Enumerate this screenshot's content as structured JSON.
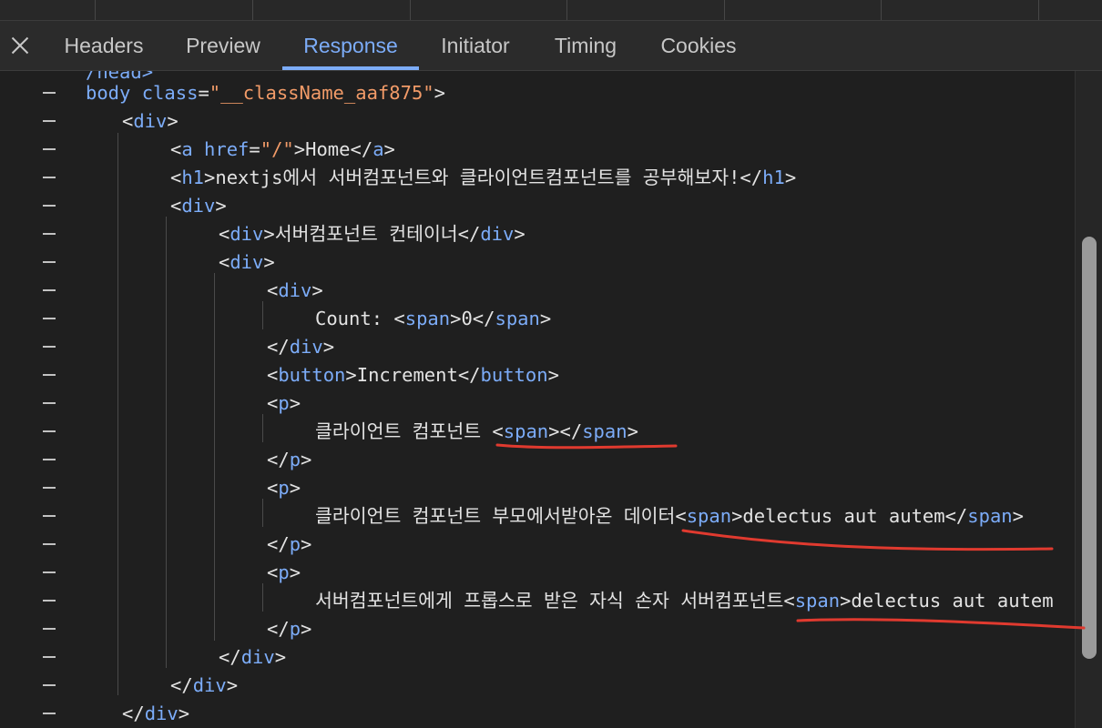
{
  "tabs": {
    "headers": "Headers",
    "preview": "Preview",
    "response": "Response",
    "initiator": "Initiator",
    "timing": "Timing",
    "cookies": "Cookies",
    "active": "Response"
  },
  "icons": {
    "close": "close-icon"
  },
  "colors": {
    "accent": "#7cacf8",
    "tag": "#7cacf8",
    "string": "#f29b68",
    "text": "#e3e3e3",
    "background": "#1f1f1f",
    "annotation": "#e03a2f"
  },
  "code": {
    "partial_head": "/head>",
    "body_open": [
      {
        "t": "at",
        "v": "body"
      },
      {
        "t": "tx",
        "v": " "
      },
      {
        "t": "at",
        "v": "class"
      },
      {
        "t": "tx",
        "v": "="
      },
      {
        "t": "st",
        "v": "\"__className_aaf875\""
      },
      {
        "t": "tx",
        "v": ">"
      }
    ],
    "lines": [
      [
        {
          "t": "tx",
          "v": "<"
        },
        {
          "t": "tg",
          "v": "div"
        },
        {
          "t": "tx",
          "v": ">"
        }
      ],
      [
        {
          "t": "tx",
          "v": "<"
        },
        {
          "t": "tg",
          "v": "a"
        },
        {
          "t": "tx",
          "v": " "
        },
        {
          "t": "at",
          "v": "href"
        },
        {
          "t": "tx",
          "v": "="
        },
        {
          "t": "st",
          "v": "\"/\""
        },
        {
          "t": "tx",
          "v": ">Home</"
        },
        {
          "t": "tg",
          "v": "a"
        },
        {
          "t": "tx",
          "v": ">"
        }
      ],
      [
        {
          "t": "tx",
          "v": "<"
        },
        {
          "t": "tg",
          "v": "h1"
        },
        {
          "t": "tx",
          "v": ">nextjs에서 서버컴포넌트와 클라이언트컴포넌트를 공부해보자!</"
        },
        {
          "t": "tg",
          "v": "h1"
        },
        {
          "t": "tx",
          "v": ">"
        }
      ],
      [
        {
          "t": "tx",
          "v": "<"
        },
        {
          "t": "tg",
          "v": "div"
        },
        {
          "t": "tx",
          "v": ">"
        }
      ],
      [
        {
          "t": "tx",
          "v": "<"
        },
        {
          "t": "tg",
          "v": "div"
        },
        {
          "t": "tx",
          "v": ">서버컴포넌트 컨테이너</"
        },
        {
          "t": "tg",
          "v": "div"
        },
        {
          "t": "tx",
          "v": ">"
        }
      ],
      [
        {
          "t": "tx",
          "v": "<"
        },
        {
          "t": "tg",
          "v": "div"
        },
        {
          "t": "tx",
          "v": ">"
        }
      ],
      [
        {
          "t": "tx",
          "v": "<"
        },
        {
          "t": "tg",
          "v": "div"
        },
        {
          "t": "tx",
          "v": ">"
        }
      ],
      [
        {
          "t": "tx",
          "v": "Count: <"
        },
        {
          "t": "tg",
          "v": "span"
        },
        {
          "t": "tx",
          "v": ">0</"
        },
        {
          "t": "tg",
          "v": "span"
        },
        {
          "t": "tx",
          "v": ">"
        }
      ],
      [
        {
          "t": "tx",
          "v": "</"
        },
        {
          "t": "tg",
          "v": "div"
        },
        {
          "t": "tx",
          "v": ">"
        }
      ],
      [
        {
          "t": "tx",
          "v": "<"
        },
        {
          "t": "tg",
          "v": "button"
        },
        {
          "t": "tx",
          "v": ">Increment</"
        },
        {
          "t": "tg",
          "v": "button"
        },
        {
          "t": "tx",
          "v": ">"
        }
      ],
      [
        {
          "t": "tx",
          "v": "<"
        },
        {
          "t": "tg",
          "v": "p"
        },
        {
          "t": "tx",
          "v": ">"
        }
      ],
      [
        {
          "t": "tx",
          "v": "클라이언트 컴포넌트 <"
        },
        {
          "t": "tg",
          "v": "span"
        },
        {
          "t": "tx",
          "v": "></"
        },
        {
          "t": "tg",
          "v": "span"
        },
        {
          "t": "tx",
          "v": ">"
        }
      ],
      [
        {
          "t": "tx",
          "v": "</"
        },
        {
          "t": "tg",
          "v": "p"
        },
        {
          "t": "tx",
          "v": ">"
        }
      ],
      [
        {
          "t": "tx",
          "v": "<"
        },
        {
          "t": "tg",
          "v": "p"
        },
        {
          "t": "tx",
          "v": ">"
        }
      ],
      [
        {
          "t": "tx",
          "v": "클라이언트 컴포넌트 부모에서받아온 데이터<"
        },
        {
          "t": "tg",
          "v": "span"
        },
        {
          "t": "tx",
          "v": ">delectus aut autem</"
        },
        {
          "t": "tg",
          "v": "span"
        },
        {
          "t": "tx",
          "v": ">"
        }
      ],
      [
        {
          "t": "tx",
          "v": "</"
        },
        {
          "t": "tg",
          "v": "p"
        },
        {
          "t": "tx",
          "v": ">"
        }
      ],
      [
        {
          "t": "tx",
          "v": "<"
        },
        {
          "t": "tg",
          "v": "p"
        },
        {
          "t": "tx",
          "v": ">"
        }
      ],
      [
        {
          "t": "tx",
          "v": "서버컴포넌트에게 프롭스로 받은 자식 손자 서버컴포넌트<"
        },
        {
          "t": "tg",
          "v": "span"
        },
        {
          "t": "tx",
          "v": ">delectus aut autem"
        }
      ],
      [
        {
          "t": "tx",
          "v": "</"
        },
        {
          "t": "tg",
          "v": "p"
        },
        {
          "t": "tx",
          "v": ">"
        }
      ],
      [
        {
          "t": "tx",
          "v": "</"
        },
        {
          "t": "tg",
          "v": "div"
        },
        {
          "t": "tx",
          "v": ">"
        }
      ],
      [
        {
          "t": "tx",
          "v": "</"
        },
        {
          "t": "tg",
          "v": "div"
        },
        {
          "t": "tx",
          "v": ">"
        }
      ],
      [
        {
          "t": "tx",
          "v": "</"
        },
        {
          "t": "tg",
          "v": "div"
        },
        {
          "t": "tx",
          "v": ">"
        }
      ]
    ]
  }
}
